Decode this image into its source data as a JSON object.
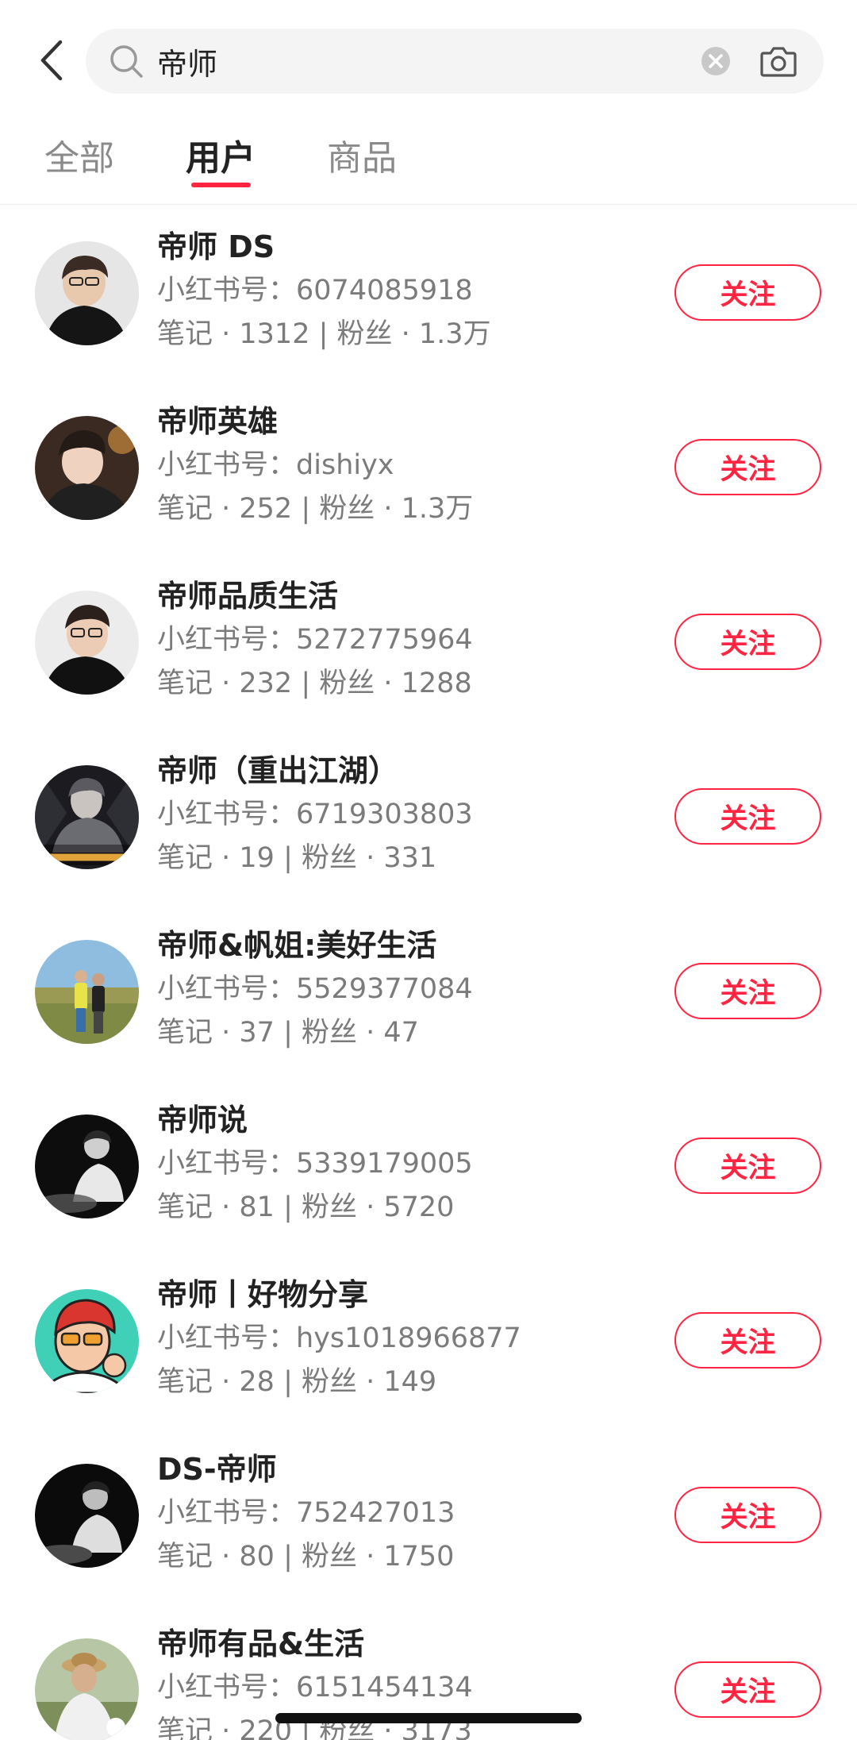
{
  "search": {
    "query": "帝师"
  },
  "tabs": [
    {
      "label": "全部"
    },
    {
      "label": "用户"
    },
    {
      "label": "商品"
    }
  ],
  "active_tab": "用户",
  "labels": {
    "redid_prefix": "小红书号：",
    "notes_prefix": "笔记 · ",
    "separator": " | ",
    "fans_prefix": "粉丝 · "
  },
  "users": [
    {
      "name": "帝师 DS",
      "redid": "6074085918",
      "notes": "1312",
      "fans": "1.3万",
      "follow_label": "关注"
    },
    {
      "name": "帝师英雄",
      "redid": "dishiyx",
      "notes": "252",
      "fans": "1.3万",
      "follow_label": "关注"
    },
    {
      "name": "帝师品质生活",
      "redid": "5272775964",
      "notes": "232",
      "fans": "1288",
      "follow_label": "关注"
    },
    {
      "name": "帝师（重出江湖）",
      "redid": "6719303803",
      "notes": "19",
      "fans": "331",
      "follow_label": "关注"
    },
    {
      "name": "帝师&帆姐:美好生活",
      "redid": "5529377084",
      "notes": "37",
      "fans": "47",
      "follow_label": "关注"
    },
    {
      "name": "帝师说",
      "redid": "5339179005",
      "notes": "81",
      "fans": "5720",
      "follow_label": "关注"
    },
    {
      "name": "帝师丨好物分享",
      "redid": "hys1018966877",
      "notes": "28",
      "fans": "149",
      "follow_label": "关注"
    },
    {
      "name": "DS-帝师",
      "redid": "752427013",
      "notes": "80",
      "fans": "1750",
      "follow_label": "关注"
    },
    {
      "name": "帝师有品&生活",
      "redid": "6151454134",
      "notes": "220",
      "fans": "3173",
      "follow_label": "关注"
    }
  ],
  "colors": {
    "accent": "#ff2442",
    "text_primary": "#222222",
    "text_secondary": "#7b7b7b",
    "search_bg": "#f4f4f4"
  },
  "icons": {
    "back": "chevron-left-icon",
    "search": "search-icon",
    "clear": "clear-circle-icon",
    "camera": "camera-icon"
  }
}
